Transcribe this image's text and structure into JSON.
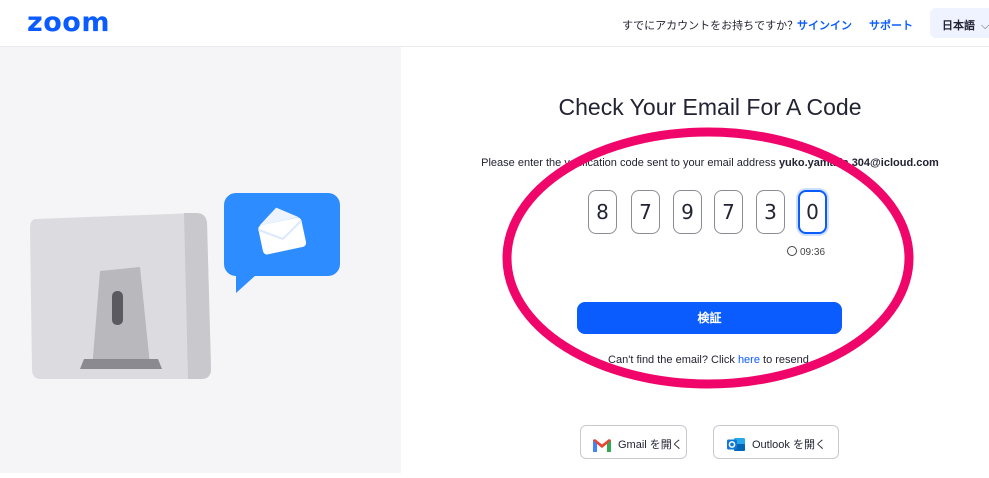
{
  "header": {
    "logo": "zoom",
    "account_question": "すでにアカウントをお持ちですか？",
    "signin_label": "サインイン",
    "support_label": "サポート",
    "language_label": "日本語"
  },
  "main": {
    "title": "Check Your Email For A Code",
    "instructions_prefix": "Please enter the verification code sent to your email address ",
    "email": "yuko.yamada.304@icloud.com",
    "code_digits": [
      "8",
      "7",
      "9",
      "7",
      "3",
      "0"
    ],
    "timer": "09:36",
    "verify_label": "検証",
    "resend_prefix": "Can't find the email? Click ",
    "resend_link": "here",
    "resend_suffix": " to resend."
  },
  "mail_buttons": {
    "gmail_label": "Gmail を開く",
    "outlook_label": "Outlook を開く"
  },
  "colors": {
    "brand": "#0b5cff",
    "annotation": "#f0066a",
    "panel_bg": "#f5f5f7"
  }
}
